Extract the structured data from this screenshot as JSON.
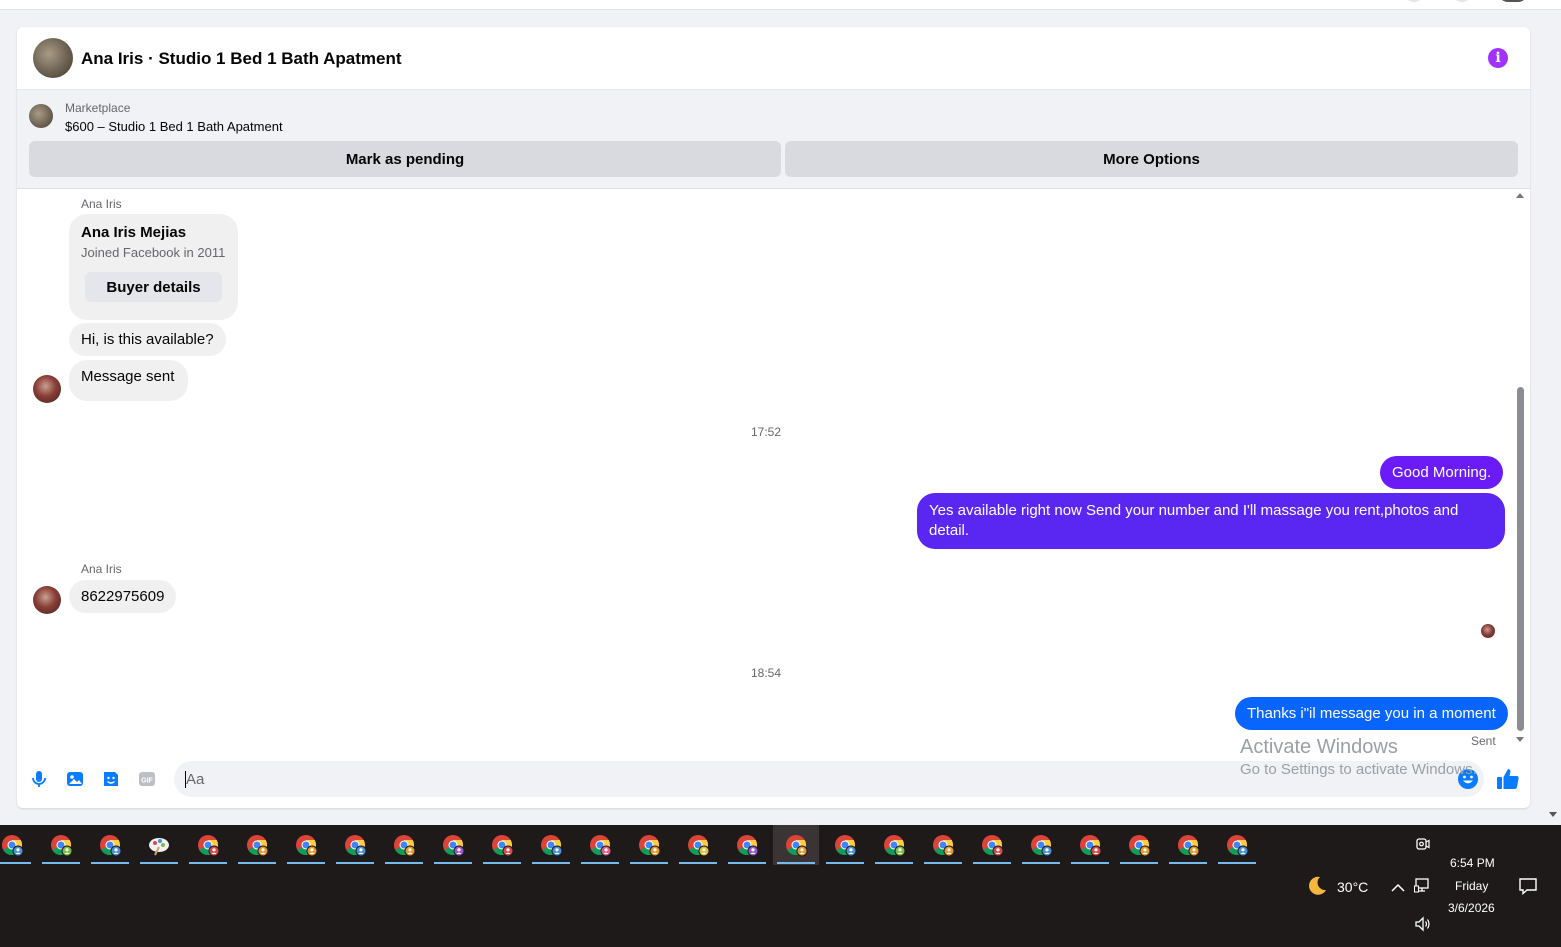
{
  "conversation": {
    "title": "Ana Iris · Studio 1 Bed 1 Bath Apatment"
  },
  "marketplace": {
    "label": "Marketplace",
    "listing": "$600 – Studio 1 Bed 1 Bath Apatment",
    "pending_label": "Mark as pending",
    "more_label": "More Options"
  },
  "messages": {
    "sender_name_1": "Ana Iris",
    "buyer_card": {
      "name": "Ana Iris Mejias",
      "joined": "Joined Facebook in 2011",
      "button": "Buyer details"
    },
    "in_1": "Hi, is this available?",
    "in_2": "Message sent",
    "time_1": "17:52",
    "out_1": "Good Morning.",
    "out_2": "Yes available right now Send your number and I'll massage you rent,photos and detail.",
    "sender_name_2": "Ana Iris",
    "in_3": "8622975609",
    "time_2": "18:54",
    "out_3": "Thanks i\"il message you in a moment",
    "status": "Sent"
  },
  "composer": {
    "placeholder": "Aa"
  },
  "watermark": {
    "title": "Activate Windows",
    "subtitle": "Go to Settings to activate Windows."
  },
  "taskbar": {
    "weather_temp": "30°C",
    "time": "6:54 PM",
    "day": "Friday",
    "date": "3/6/2026"
  },
  "colors": {
    "purple_bubble": "#6b1bf5",
    "blue_bubble": "#0866ff",
    "messenger_blue": "#0a7cff",
    "info_purple": "#a033ff"
  }
}
